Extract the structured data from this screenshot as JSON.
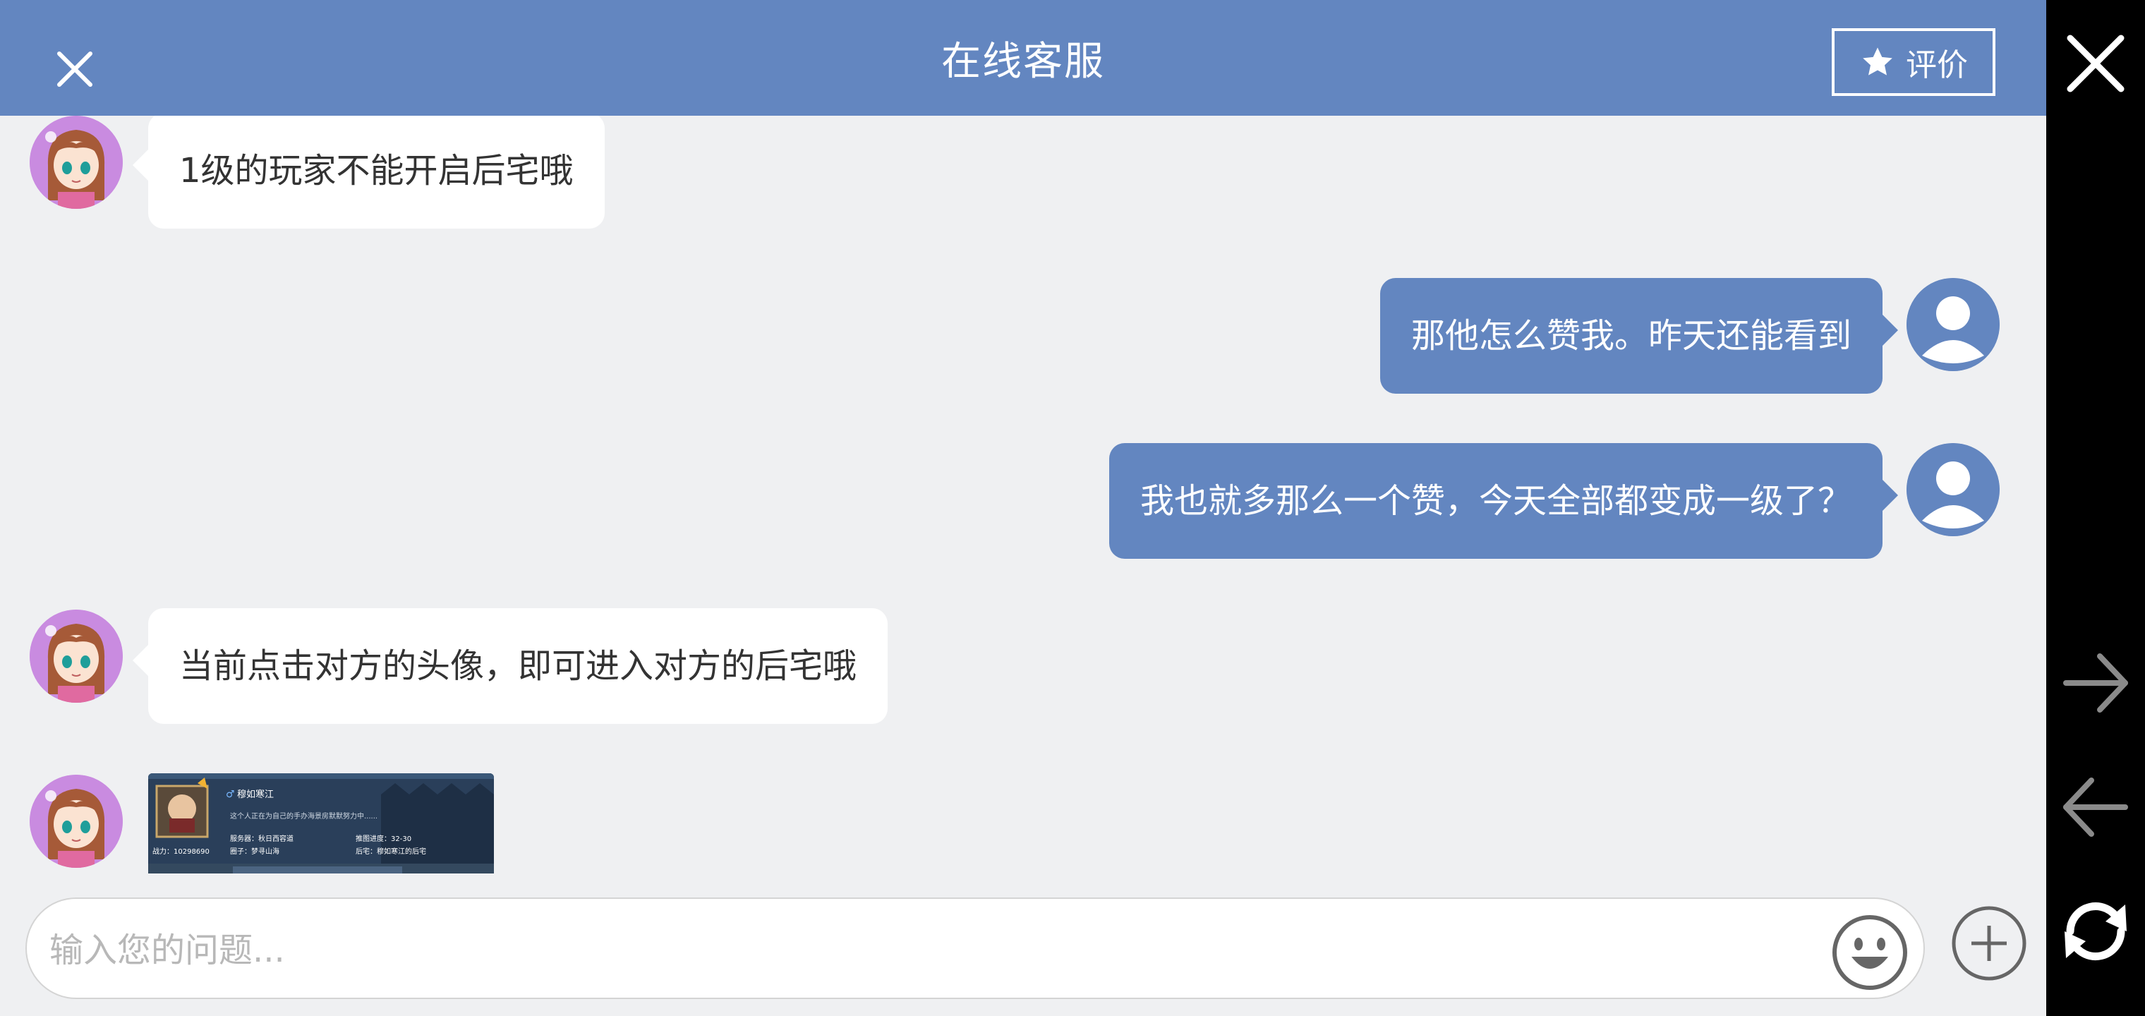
{
  "header": {
    "title": "在线客服",
    "rate_label": "评价"
  },
  "messages": [
    {
      "from": "agent",
      "text": "1级的玩家不能开启后宅哦"
    },
    {
      "from": "user",
      "text": "那他怎么赞我。昨天还能看到"
    },
    {
      "from": "user",
      "text": "我也就多那么一个赞，今天全部都变成一级了？"
    },
    {
      "from": "agent",
      "text": "当前点击对方的头像，即可进入对方的后宅哦"
    },
    {
      "from": "agent",
      "type": "image"
    }
  ],
  "shared_image": {
    "gender_symbol": "♂",
    "player_name": "穆如寒江",
    "bio": "这个人正在为自己的手办海景房默默努力中......",
    "server_label": "服务器：秋日西容道",
    "progress_label": "推图进度：32-30",
    "circle_label": "圈子：梦寻山海",
    "house_label": "后宅：穆如寒江的后宅",
    "power_label": "战力：10298690"
  },
  "input": {
    "placeholder": "输入您的问题..."
  },
  "icons": {
    "close": "close-icon",
    "star": "star-icon",
    "emoji": "smiley-icon",
    "plus": "plus-icon",
    "side_close": "close-icon",
    "forward": "arrow-right-icon",
    "back": "arrow-left-icon",
    "refresh": "refresh-icon"
  },
  "colors": {
    "header": "#6386c0",
    "user_bubble": "#6386c0",
    "agent_bubble": "#ffffff",
    "background": "#eff0f2",
    "sidebar": "#000000"
  }
}
